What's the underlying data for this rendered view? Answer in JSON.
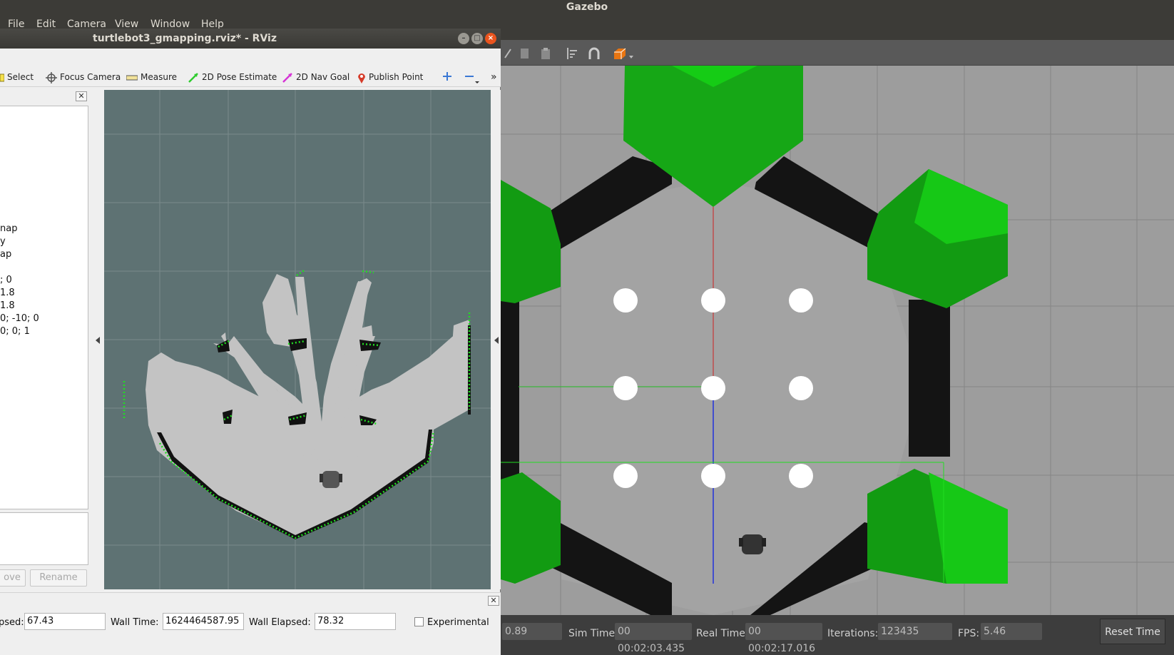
{
  "gazebo": {
    "window_title": "Gazebo",
    "status": {
      "factor_value": "0.89",
      "sim_time_label": "Sim Time:",
      "sim_time_value": "00 00:02:03.435",
      "real_time_label": "Real Time:",
      "real_time_value": "00 00:02:17.016",
      "iterations_label": "Iterations:",
      "iterations_value": "123435",
      "fps_label": "FPS:",
      "fps_value": "5.46",
      "reset_label": "Reset Time"
    },
    "colors": {
      "hexagon_green": "#11aa11",
      "wall": "#141414",
      "ground": "#9d9d9d"
    }
  },
  "menubar": {
    "file": "File",
    "edit": "Edit",
    "camera": "Camera",
    "view": "View",
    "window": "Window",
    "help": "Help"
  },
  "rviz": {
    "window_title": "turtlebot3_gmapping.rviz* - RViz",
    "toolbar": {
      "select": "Select",
      "focus_camera": "Focus Camera",
      "measure": "Measure",
      "pose_estimate": "2D Pose Estimate",
      "nav_goal": "2D Nav Goal",
      "publish_point": "Publish Point",
      "more": "»"
    },
    "displays_fragments": [
      "nap",
      "y",
      "ap",
      "; 0",
      "1.8",
      "1.8",
      "0; -10; 0",
      "0; 0; 1"
    ],
    "buttons": {
      "remove": "ove",
      "rename": "Rename"
    },
    "time": {
      "elapsed_label": "psed:",
      "elapsed_value": "67.43",
      "wall_time_label": "Wall Time:",
      "wall_time_value": "1624464587.95",
      "wall_elapsed_label": "Wall Elapsed:",
      "wall_elapsed_value": "78.32",
      "experimental_label": "Experimental"
    },
    "colors": {
      "map_unknown": "#5e7273",
      "map_free": "#c3c3c3",
      "laser": "#22dd22"
    }
  }
}
